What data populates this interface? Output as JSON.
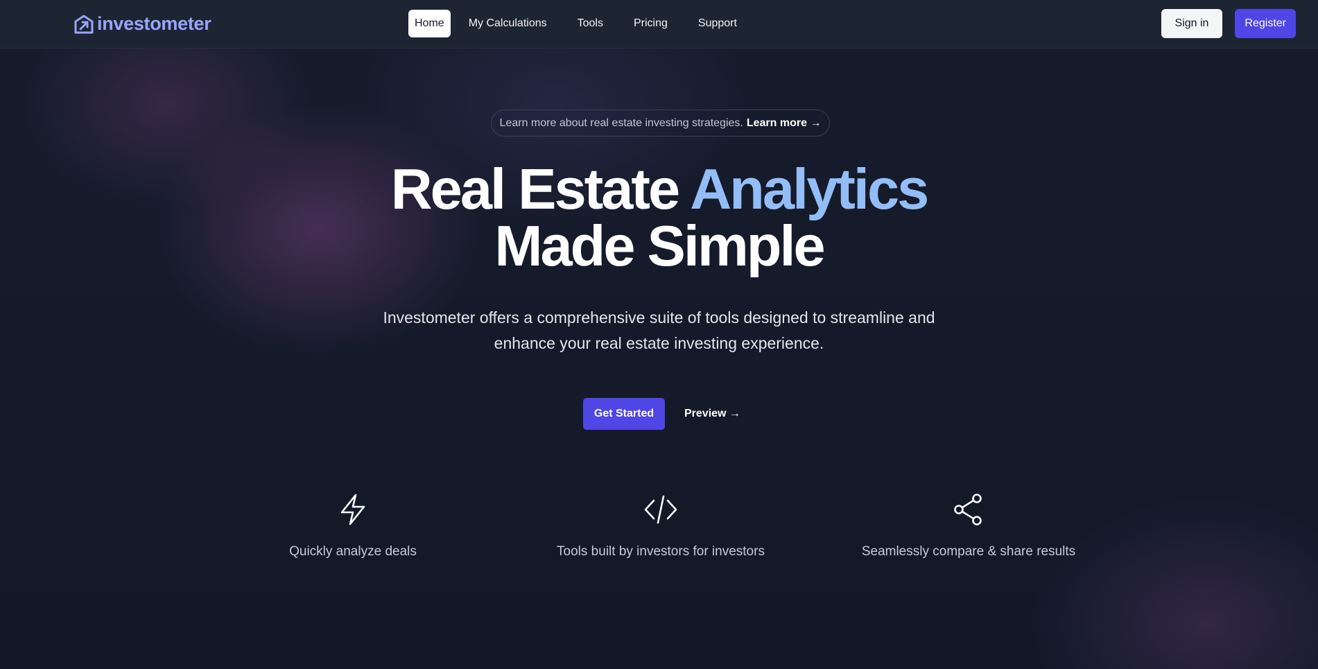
{
  "brand": {
    "name": "investometer",
    "color": "#9aa4ff"
  },
  "nav": {
    "links": [
      {
        "label": "Home",
        "active": true
      },
      {
        "label": "My Calculations",
        "active": false
      },
      {
        "label": "Tools",
        "active": false
      },
      {
        "label": "Pricing",
        "active": false
      },
      {
        "label": "Support",
        "active": false
      }
    ],
    "sign_in": "Sign in",
    "register": "Register"
  },
  "hero": {
    "pill_text": "Learn more about real estate investing strategies.",
    "pill_link": "Learn more →",
    "headline_part1": "Real Estate",
    "headline_accent": "Analytics",
    "headline_line2": "Made Simple",
    "subtitle": "Investometer offers a comprehensive suite of tools designed to streamline and enhance your real estate investing experience.",
    "cta_primary": "Get Started",
    "cta_secondary": "Preview →"
  },
  "features": [
    {
      "icon": "lightning-bolt-icon",
      "label": "Quickly analyze deals"
    },
    {
      "icon": "code-brackets-icon",
      "label": "Tools built by investors for investors"
    },
    {
      "icon": "share-icon",
      "label": "Seamlessly compare & share results"
    }
  ],
  "colors": {
    "accent": "#4f46e5",
    "headline_accent": "#93bdf7",
    "background": "#141a29",
    "nav_background": "#1d2532"
  }
}
